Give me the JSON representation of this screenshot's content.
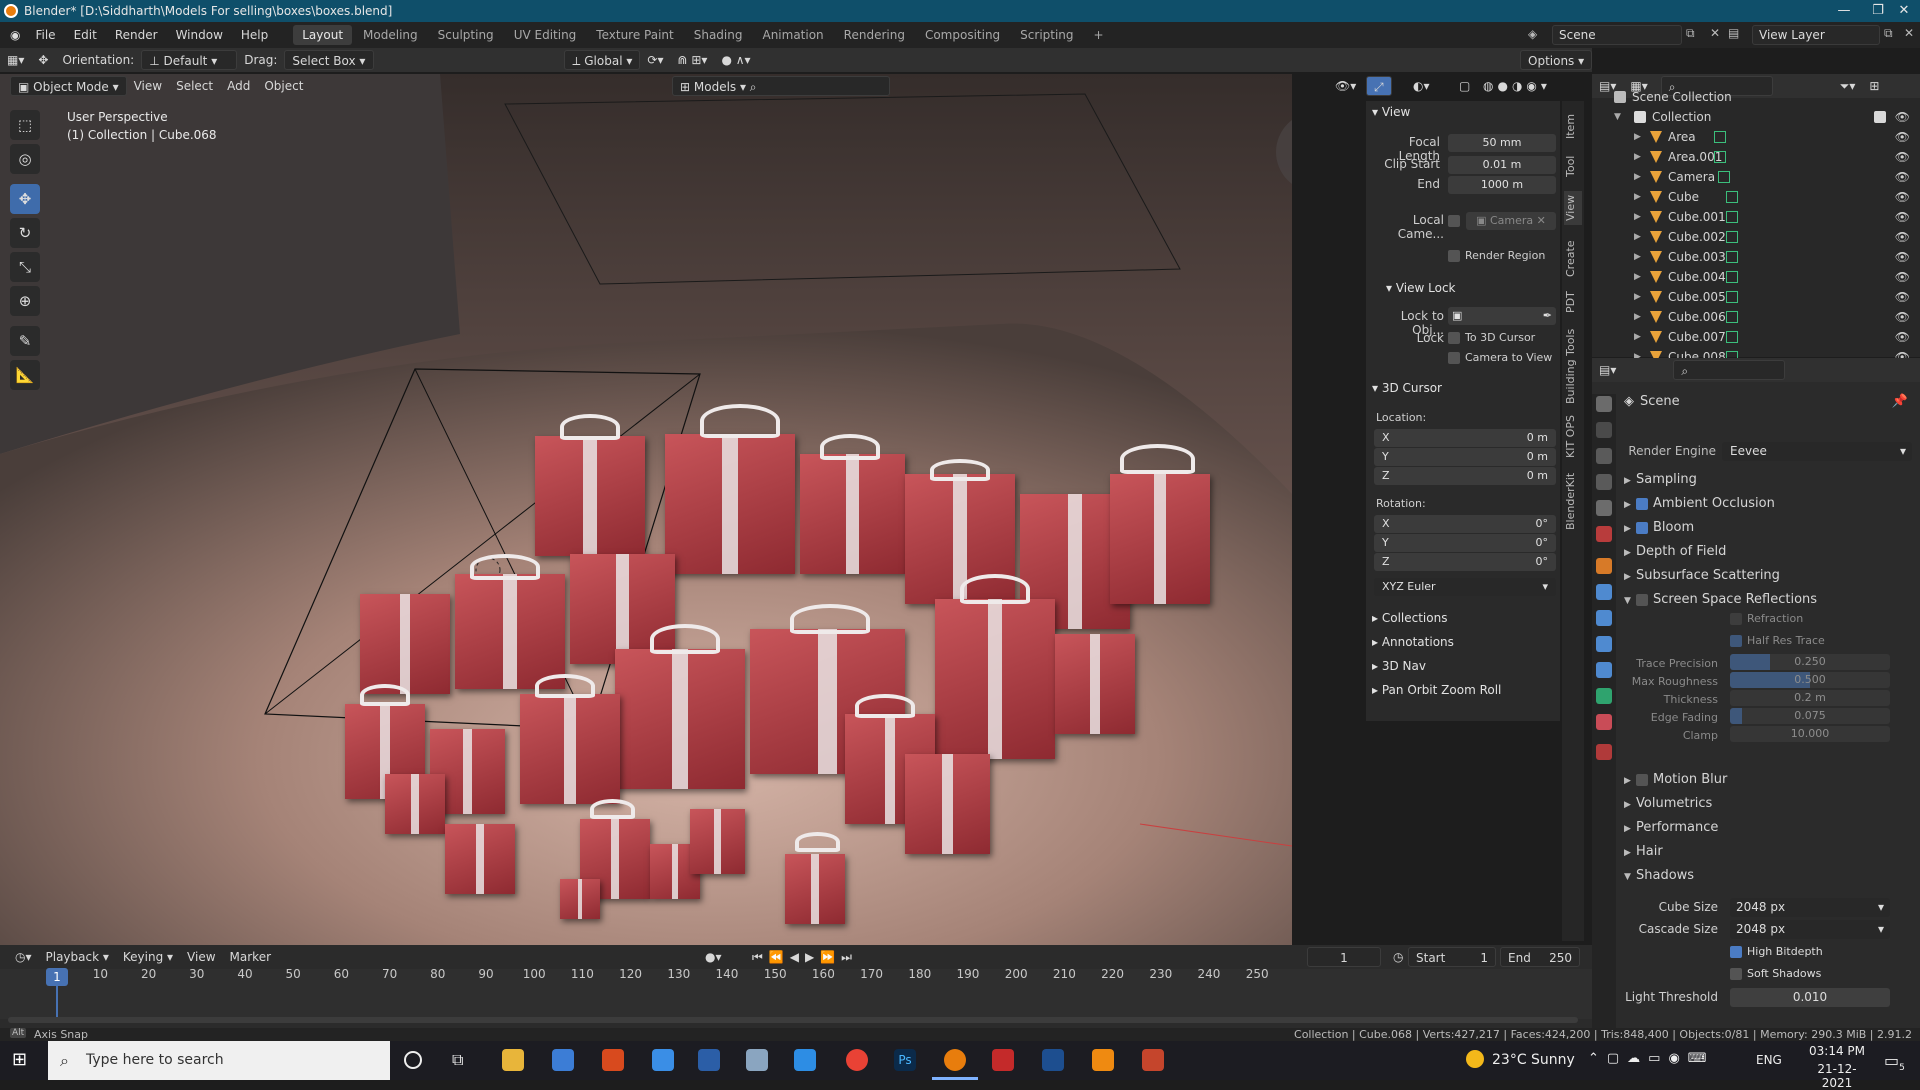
{
  "window": {
    "title": "Blender* [D:\\Siddharth\\Models For selling\\boxes\\boxes.blend]"
  },
  "menu": [
    "File",
    "Edit",
    "Render",
    "Window",
    "Help"
  ],
  "workspaces": [
    "Layout",
    "Modeling",
    "Sculpting",
    "UV Editing",
    "Texture Paint",
    "Shading",
    "Animation",
    "Rendering",
    "Compositing",
    "Scripting"
  ],
  "active_workspace": "Layout",
  "scene_name": "Scene",
  "view_layer": "View Layer",
  "toolbar": {
    "orientation_label": "Orientation:",
    "orientation_value": "Default",
    "drag_label": "Drag:",
    "drag_value": "Select Box",
    "transform_space": "Global",
    "options": "Options"
  },
  "viewport_header": {
    "mode": "Object Mode",
    "menus": [
      "View",
      "Select",
      "Add",
      "Object"
    ],
    "collection_filter": "Models"
  },
  "viewport": {
    "perspective": "User Perspective",
    "context": "(1) Collection | Cube.068"
  },
  "npanel": {
    "view_title": "View",
    "focal_length_label": "Focal Length",
    "focal_length": "50 mm",
    "clip_start_label": "Clip Start",
    "clip_start": "0.01 m",
    "clip_end_label": "End",
    "clip_end": "1000 m",
    "local_camera_label": "Local Came...",
    "local_camera": "Camera",
    "render_region": "Render Region",
    "view_lock_title": "View Lock",
    "lock_to_obj_label": "Lock to Obj...",
    "lock_label": "Lock",
    "to_3d_cursor": "To 3D Cursor",
    "camera_to_view": "Camera to View",
    "cursor_title": "3D Cursor",
    "location_label": "Location:",
    "loc": [
      {
        "axis": "X",
        "value": "0 m"
      },
      {
        "axis": "Y",
        "value": "0 m"
      },
      {
        "axis": "Z",
        "value": "0 m"
      }
    ],
    "rotation_label": "Rotation:",
    "rot": [
      {
        "axis": "X",
        "value": "0°"
      },
      {
        "axis": "Y",
        "value": "0°"
      },
      {
        "axis": "Z",
        "value": "0°"
      }
    ],
    "rotation_mode": "XYZ Euler",
    "collapsed_panels": [
      "Collections",
      "Annotations",
      "3D Nav",
      "Pan Orbit Zoom Roll"
    ],
    "side_tabs": [
      "Item",
      "Tool",
      "View",
      "Create",
      "PDT",
      "Building Tools",
      "KIT OPS",
      "BlenderKit"
    ]
  },
  "outliner": {
    "root": "Scene Collection",
    "collection": "Collection",
    "items": [
      {
        "name": "Area",
        "type": "light"
      },
      {
        "name": "Area.001",
        "type": "light"
      },
      {
        "name": "Camera",
        "type": "camera"
      },
      {
        "name": "Cube",
        "type": "mesh"
      },
      {
        "name": "Cube.001",
        "type": "mesh"
      },
      {
        "name": "Cube.002",
        "type": "mesh"
      },
      {
        "name": "Cube.003",
        "type": "mesh"
      },
      {
        "name": "Cube.004",
        "type": "mesh"
      },
      {
        "name": "Cube.005",
        "type": "mesh"
      },
      {
        "name": "Cube.006",
        "type": "mesh"
      },
      {
        "name": "Cube.007",
        "type": "mesh"
      },
      {
        "name": "Cube.008",
        "type": "mesh"
      }
    ]
  },
  "properties": {
    "context": "Scene",
    "render_engine_label": "Render Engine",
    "render_engine": "Eevee",
    "panels": [
      {
        "label": "Sampling",
        "checkbox": null
      },
      {
        "label": "Ambient Occlusion",
        "checkbox": true
      },
      {
        "label": "Bloom",
        "checkbox": true
      },
      {
        "label": "Depth of Field",
        "checkbox": null
      },
      {
        "label": "Subsurface Scattering",
        "checkbox": null
      },
      {
        "label": "Screen Space Reflections",
        "checkbox": false
      }
    ],
    "ssr": {
      "refraction": "Refraction",
      "half_res_trace": "Half Res Trace",
      "fields": [
        {
          "label": "Trace Precision",
          "value": "0.250",
          "fraction": 0.25
        },
        {
          "label": "Max Roughness",
          "value": "0.500",
          "fraction": 0.5
        },
        {
          "label": "Thickness",
          "value": "0.2 m",
          "fraction": 0
        },
        {
          "label": "Edge Fading",
          "value": "0.075",
          "fraction": 0.075
        },
        {
          "label": "Clamp",
          "value": "10.000",
          "fraction": 0
        }
      ]
    },
    "more_panels": [
      {
        "label": "Motion Blur",
        "checkbox": false
      },
      {
        "label": "Volumetrics",
        "checkbox": null
      },
      {
        "label": "Performance",
        "checkbox": null
      },
      {
        "label": "Hair",
        "checkbox": null
      }
    ],
    "shadows": {
      "title": "Shadows",
      "cube_size_label": "Cube Size",
      "cube_size": "2048 px",
      "cascade_size_label": "Cascade Size",
      "cascade_size": "2048 px",
      "high_bitdepth": "High Bitdepth",
      "soft_shadows": "Soft Shadows",
      "light_threshold_label": "Light Threshold",
      "light_threshold": "0.010"
    }
  },
  "timeline": {
    "menus": [
      "Playback",
      "Keying",
      "View",
      "Marker"
    ],
    "current_frame": "1",
    "start_label": "Start",
    "start": "1",
    "end_label": "End",
    "end": "250",
    "ticks": [
      "1",
      "10",
      "20",
      "30",
      "40",
      "50",
      "60",
      "70",
      "80",
      "90",
      "100",
      "110",
      "120",
      "130",
      "140",
      "150",
      "160",
      "170",
      "180",
      "190",
      "200",
      "210",
      "220",
      "230",
      "240",
      "250"
    ]
  },
  "status": {
    "left": "Axis Snap",
    "right": "Collection | Cube.068 | Verts:427,217 | Faces:424,200 | Tris:848,400 | Objects:0/81 | Memory: 290.3 MiB | 2.91.2"
  },
  "taskbar": {
    "search_placeholder": "Type here to search",
    "weather": "23°C  Sunny",
    "lang": "ENG",
    "time": "03:14 PM",
    "date": "21-12-2021",
    "notif_count": "5"
  },
  "colors": {
    "accent": "#4772b3",
    "gift_red": "#b0373d",
    "ribbon": "#ece7e7"
  }
}
